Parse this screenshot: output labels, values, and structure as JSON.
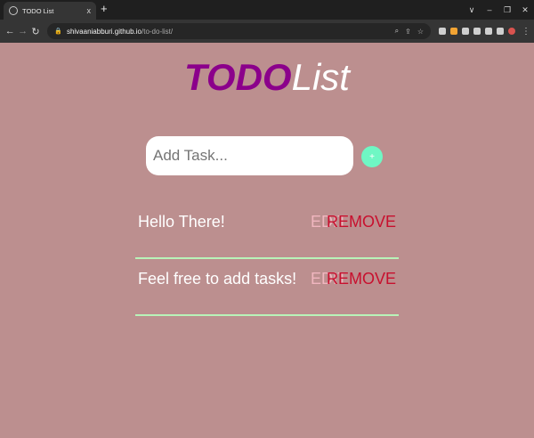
{
  "browser": {
    "tab_title": "TODO List",
    "tab_close": "x",
    "new_tab": "+",
    "url_host": "shivaaniabburi.github.io",
    "url_path": "/to-do-list/",
    "window_controls": [
      "∨",
      "–",
      "❐",
      "✕"
    ]
  },
  "logo": {
    "todo": "TODO",
    "list": "List",
    "colors": {
      "todo": "#8b008b",
      "list": "#ffffff"
    }
  },
  "task_input": {
    "placeholder": "Add Task...",
    "value": ""
  },
  "add_button": {
    "icon": "plus-icon",
    "label": "+"
  },
  "tasks": [
    {
      "text": "Hello There!",
      "edit_label": "EDIT",
      "remove_label": "REMOVE"
    },
    {
      "text": "Feel free to add tasks!",
      "edit_label": "EDIT",
      "remove_label": "REMOVE"
    }
  ],
  "colors": {
    "background": "#bc8f8f",
    "add_button": "#6ff7c4",
    "edit": "#f0b6bf",
    "remove": "#c8102e",
    "divider": "#b8f3b8"
  }
}
